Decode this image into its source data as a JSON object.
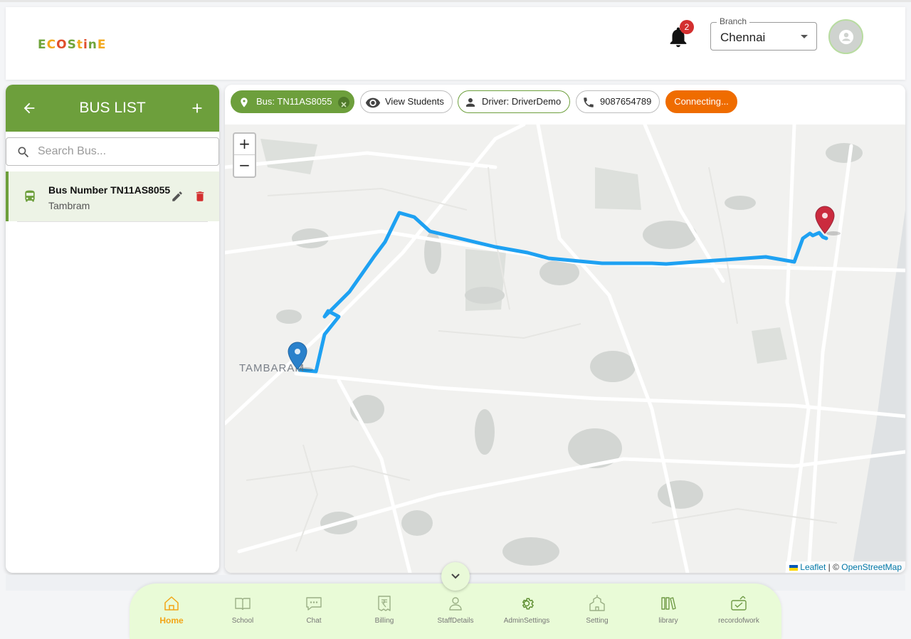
{
  "header": {
    "logo_text": [
      "E",
      "C",
      "O",
      "S",
      "t",
      "i",
      "n",
      "E"
    ],
    "notifications_count": "2",
    "branch": {
      "label": "Branch",
      "value": "Chennai"
    }
  },
  "sidebar": {
    "title": "BUS LIST",
    "search_placeholder": "Search Bus...",
    "buses": [
      {
        "number": "Bus Number TN11AS8055",
        "location": "Tambram"
      }
    ]
  },
  "map_header": {
    "bus_chip": "Bus: TN11AS8055",
    "students_chip": "View Students",
    "driver_chip": "Driver: DriverDemo",
    "phone_chip": "9087654789",
    "status_chip": "Connecting..."
  },
  "map": {
    "zoom_in": "+",
    "zoom_out": "−",
    "place_label": "TAMBARAM",
    "attribution_leaflet": "Leaflet",
    "attribution_sep": " | © ",
    "attribution_osm": "OpenStreetMap",
    "route_color": "#1ea1f2",
    "start_marker_color": "#2a81cb",
    "end_marker_color": "#cb2b3e"
  },
  "bottom_nav": [
    {
      "label": "Home",
      "icon": "home-icon",
      "active": true
    },
    {
      "label": "School",
      "icon": "book-icon"
    },
    {
      "label": "Chat",
      "icon": "chat-icon"
    },
    {
      "label": "Billing",
      "icon": "billing-icon"
    },
    {
      "label": "StaffDetails",
      "icon": "person-icon"
    },
    {
      "label": "AdminSettings",
      "icon": "gear-icon"
    },
    {
      "label": "Setting",
      "icon": "building-icon"
    },
    {
      "label": "library",
      "icon": "library-icon"
    },
    {
      "label": "recordofwork",
      "icon": "record-icon"
    }
  ],
  "colors": {
    "primary_green": "#6d9f3c",
    "accent_orange": "#ef6c00",
    "danger_red": "#d32f2f",
    "nav_active": "#f2a516"
  }
}
